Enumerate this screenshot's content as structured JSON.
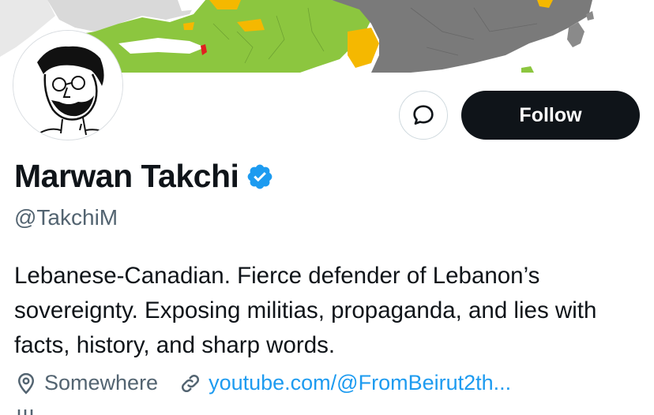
{
  "profile": {
    "name": "Marwan Takchi",
    "handle": "@TakchiM",
    "verified": true,
    "bio": "Lebanese-Canadian. Fierce defender of Lebanon’s sovereignty. Exposing militias, propaganda, and lies with facts, history, and sharp words.",
    "location": "Somewhere",
    "website": "youtube.com/@FromBeirut2th..."
  },
  "actions": {
    "follow_label": "Follow",
    "message_icon": "message-bubble-icon"
  },
  "icons": {
    "verified": "verified-badge-icon",
    "location": "location-pin-icon",
    "link": "link-icon"
  },
  "colors": {
    "primary_text": "#0f1419",
    "secondary_text": "#536471",
    "link": "#1d9bf0",
    "follow_bg": "#0f1419",
    "map_green": "#8cc63f",
    "map_yellow": "#f5b800",
    "map_gray": "#7a7a7a",
    "map_red": "#e02020"
  }
}
